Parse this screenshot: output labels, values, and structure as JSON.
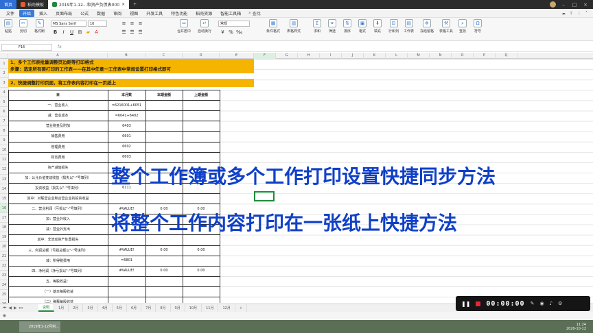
{
  "titlebar": {
    "home_tab": "首页",
    "tabs": [
      {
        "label": "稻壳模板",
        "color": "#e35d2f"
      },
      {
        "label": "2019年1-12...和资产负债表000",
        "color": "#1d8b3a"
      }
    ]
  },
  "menu": {
    "items": [
      "文件",
      "开始",
      "插入",
      "页面布局",
      "公式",
      "数据",
      "审阅",
      "视图",
      "开发工具",
      "特色功能",
      "稻壳资源",
      "智能工具箱"
    ],
    "active": "开始",
    "search": "查找"
  },
  "ribbon": {
    "font_name": "MS Sans Serif",
    "font_size": "10",
    "number_format": "常规",
    "groups": [
      "粘贴",
      "剪切",
      "复制",
      "格式刷",
      "合并居中",
      "自动换行",
      "条件格式",
      "表格样式",
      "求和",
      "筛选",
      "排序",
      "格式",
      "填充",
      "行和列",
      "工作表",
      "冻结窗格",
      "表格工具",
      "查找",
      "符号"
    ]
  },
  "formula_bar": {
    "cell_ref": "F16",
    "fx": "fx"
  },
  "columns": [
    "A",
    "B",
    "C",
    "D",
    "E",
    "F",
    "G",
    "H",
    "I",
    "J",
    "K",
    "L",
    "M",
    "N",
    "O",
    "P",
    "Q"
  ],
  "rows": [
    "1",
    "2",
    "3",
    "4",
    "5",
    "6",
    "7",
    "8",
    "9",
    "10",
    "11",
    "12",
    "13",
    "14",
    "15",
    "16",
    "17",
    "18",
    "19",
    "20",
    "21",
    "22",
    "23",
    "24",
    "25",
    "26"
  ],
  "banner": {
    "line1": "1、多个工作表批量调整页边距等打印格式",
    "line2": "步骤：选定所有要打印的工作表——在其中任意一工作表中常规设置打印格式即可",
    "line3": "2、快捷调整打印页面，将工作表内容打印在一页纸上"
  },
  "table": {
    "headers": [
      "目",
      "本月数",
      "本期金额",
      "上期金额"
    ],
    "rows": [
      {
        "item": "一、营业收入",
        "month": "=6216001+6051",
        "cur": "",
        "prev": ""
      },
      {
        "item": "减：营业成本",
        "month": "=6041+6402",
        "cur": "",
        "prev": ""
      },
      {
        "item": "营业税金及附加",
        "month": "6403",
        "cur": "",
        "prev": ""
      },
      {
        "item": "销售费用",
        "month": "6601",
        "cur": "",
        "prev": ""
      },
      {
        "item": "管理费用",
        "month": "6602",
        "cur": "",
        "prev": ""
      },
      {
        "item": "财务费用",
        "month": "6603",
        "cur": "",
        "prev": ""
      },
      {
        "item": "资产减值损失",
        "month": "",
        "cur": "",
        "prev": ""
      },
      {
        "item": "加：公允价值变动收益（损失以\"-\"号填列）",
        "month": "",
        "cur": "",
        "prev": ""
      },
      {
        "item": "投资收益（损失以\"-\"号填列）",
        "month": "6111",
        "cur": "",
        "prev": ""
      },
      {
        "item": "其中：对联营企业和合营企业的投资收益",
        "month": "",
        "cur": "",
        "prev": ""
      },
      {
        "item": "二、营业利润（亏损以\"-\"号填列）",
        "month": "#VALUE!",
        "cur": "0.00",
        "prev": "0.00"
      },
      {
        "item": "加：营业外收入",
        "month": "",
        "cur": "",
        "prev": ""
      },
      {
        "item": "减：营业外支出",
        "month": "",
        "cur": "",
        "prev": ""
      },
      {
        "item": "其中：非流动资产处置损失",
        "month": "",
        "cur": "",
        "prev": ""
      },
      {
        "item": "三、利润总额（亏损总额以\"-\"号填列）",
        "month": "#VALUE!",
        "cur": "0.00",
        "prev": "0.00"
      },
      {
        "item": "减：所得税费用",
        "month": "=6801",
        "cur": "",
        "prev": ""
      },
      {
        "item": "四、净利润（净亏损以\"-\"号填列）",
        "month": "#VALUE!",
        "cur": "0.00",
        "prev": "0.00"
      },
      {
        "item": "五、每股收益：",
        "month": "",
        "cur": "",
        "prev": ""
      },
      {
        "item": "（一）基本每股收益",
        "month": "",
        "cur": "",
        "prev": ""
      },
      {
        "item": "（二）稀释每股收益",
        "month": "",
        "cur": "",
        "prev": ""
      }
    ]
  },
  "overlay": {
    "line1": "整个工作簿或多个工作打印设置快捷同步方法",
    "line2": "将整个工作内容打印在一张纸上快捷方法"
  },
  "sheets": {
    "tabs": [
      "说明",
      "1月",
      "2月",
      "3月",
      "4月",
      "5月",
      "6月",
      "7月",
      "8月",
      "9月",
      "10月",
      "11月",
      "12月"
    ],
    "active": "说明"
  },
  "recorder": {
    "time": "00:00:00"
  },
  "taskbar": {
    "task_label": "2019年1-12月利...",
    "time": "11:24",
    "date": "2020-10-12"
  }
}
